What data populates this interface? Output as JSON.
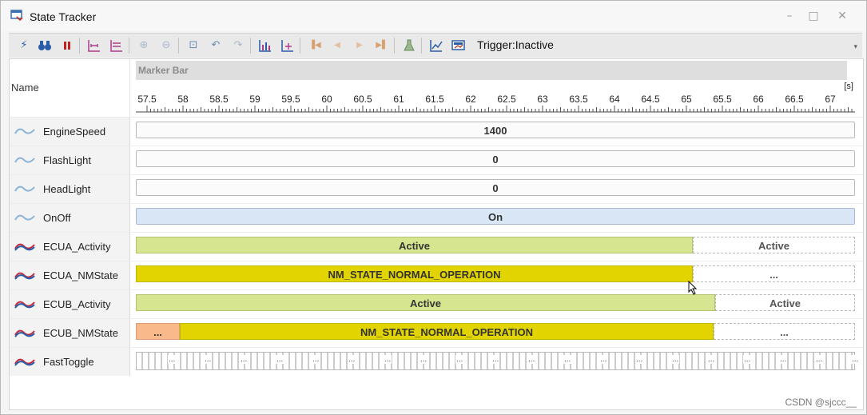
{
  "window": {
    "title": "State Tracker",
    "minimize": "–",
    "maximize": "□",
    "close": "✕"
  },
  "toolbar": {
    "trigger_text": "Trigger:Inactive",
    "more_glyph": "▾",
    "icons": [
      "flash-icon",
      "binoculars-icon",
      "pause-icon",
      "fit-view-icon",
      "fit-all-icon",
      "zoom-in-icon",
      "zoom-out-icon",
      "zoom-area-icon",
      "undo-icon",
      "redo-icon",
      "chart-icon",
      "chart-add-icon",
      "first-marker-icon",
      "prev-marker-icon",
      "next-marker-icon",
      "last-marker-icon",
      "flask-icon",
      "line-chart-icon",
      "monitor-icon"
    ]
  },
  "header": {
    "name_label": "Name",
    "marker_bar": "Marker Bar",
    "unit": "[s]"
  },
  "axis": {
    "ticks": [
      "57.5",
      "58",
      "58.5",
      "59",
      "59.5",
      "60",
      "60.5",
      "61",
      "61.5",
      "62",
      "62.5",
      "63",
      "63.5",
      "64",
      "64.5",
      "65",
      "65.5",
      "66",
      "66.5",
      "67"
    ]
  },
  "signals": [
    {
      "name": "EngineSpeed",
      "kind": "analog",
      "segments": [
        {
          "text": "1400",
          "style": "num"
        }
      ]
    },
    {
      "name": "FlashLight",
      "kind": "analog",
      "segments": [
        {
          "text": "0",
          "style": "num"
        }
      ]
    },
    {
      "name": "HeadLight",
      "kind": "analog",
      "segments": [
        {
          "text": "0",
          "style": "num"
        }
      ]
    },
    {
      "name": "OnOff",
      "kind": "analog",
      "segments": [
        {
          "text": "On",
          "style": "onoff"
        }
      ]
    },
    {
      "name": "ECUA_Activity",
      "kind": "digital",
      "segments": [
        {
          "text": "Active",
          "style": "green"
        },
        {
          "text": "Active",
          "style": "dash"
        }
      ]
    },
    {
      "name": "ECUA_NMState",
      "kind": "digital",
      "segments": [
        {
          "text": "NM_STATE_NORMAL_OPERATION",
          "style": "yellow"
        },
        {
          "text": "...",
          "style": "dash"
        }
      ]
    },
    {
      "name": "ECUB_Activity",
      "kind": "digital",
      "segments": [
        {
          "text": "Active",
          "style": "green"
        },
        {
          "text": "Active",
          "style": "dash"
        }
      ]
    },
    {
      "name": "ECUB_NMState",
      "kind": "digital",
      "segments": [
        {
          "text": "...",
          "style": "orange"
        },
        {
          "text": "NM_STATE_NORMAL_OPERATION",
          "style": "yellow"
        },
        {
          "text": "...",
          "style": "dash"
        }
      ]
    },
    {
      "name": "FastToggle",
      "kind": "digital",
      "segments": [
        {
          "text": "...",
          "style": "toggle"
        }
      ]
    }
  ],
  "watermark": "CSDN @sjccc__"
}
